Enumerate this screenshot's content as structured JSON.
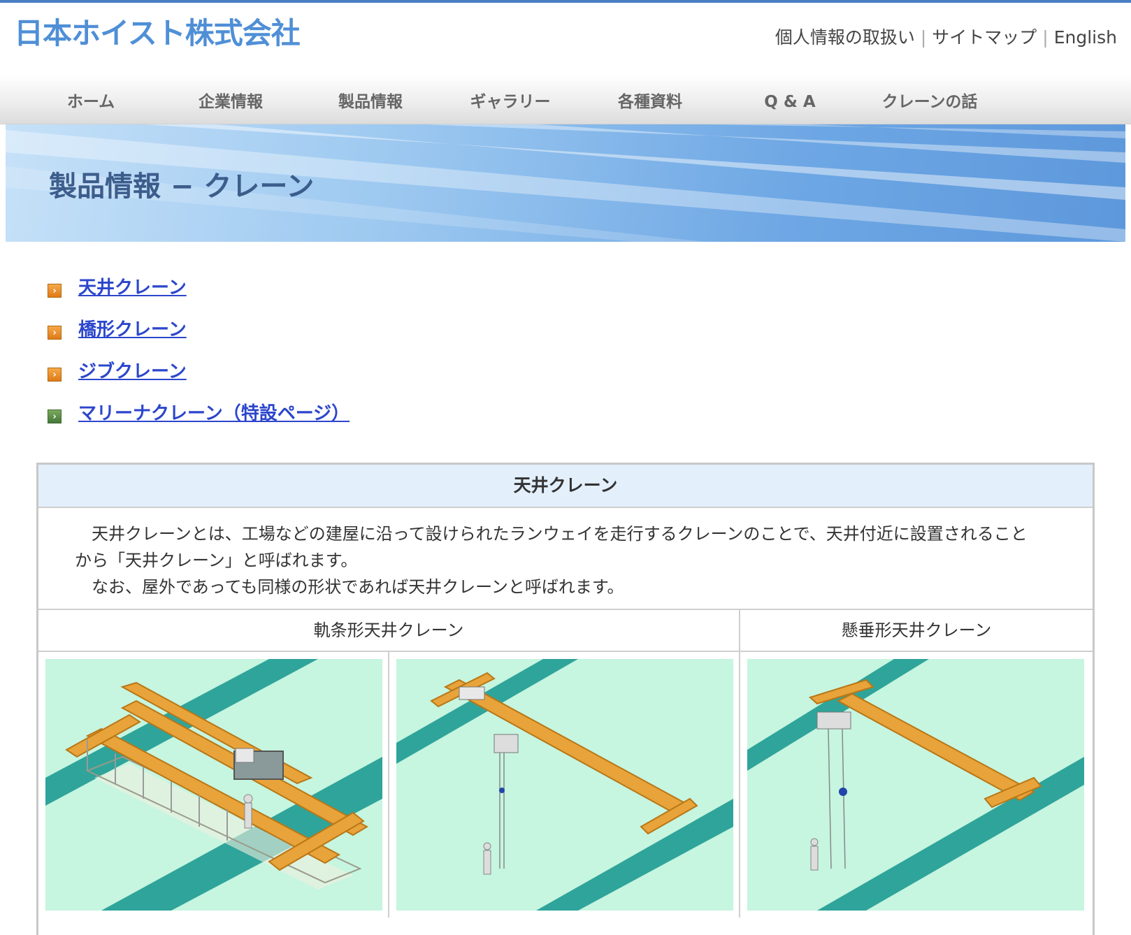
{
  "header": {
    "logo_text": "日本ホイスト株式会社",
    "util_links": [
      "個人情報の取扱い",
      "サイトマップ",
      "English"
    ]
  },
  "nav": {
    "items": [
      "ホーム",
      "企業情報",
      "製品情報",
      "ギャラリー",
      "各種資料",
      "Q & A",
      "クレーンの話"
    ]
  },
  "banner": {
    "title": "製品情報 − クレーン"
  },
  "product_links": [
    {
      "label": "天井クレーン",
      "bullet_color": "#e8841f"
    },
    {
      "label": "橋形クレーン",
      "bullet_color": "#e8841f"
    },
    {
      "label": "ジブクレーン",
      "bullet_color": "#e8841f"
    },
    {
      "label": "マリーナクレーン（特設ページ）",
      "bullet_color": "#4f8a45"
    }
  ],
  "table": {
    "title": "天井クレーン",
    "description_1": "天井クレーンとは、工場などの建屋に沿って設けられたランウェイを走行するクレーンのことで、天井付近に設置されることから「天井クレーン」と呼ばれます。",
    "description_2": "なお、屋外であっても同様の形状であれば天井クレーンと呼ばれます。",
    "sub_left": "軌条形天井クレーン",
    "sub_right": "懸垂形天井クレーン"
  },
  "colors": {
    "accent": "#4f8fd6",
    "link": "#2b46cc",
    "table_header_bg": "#e3effb",
    "illustration_bg": "#c6f5e0",
    "runway": "#2fa49a",
    "girder": "#e8a33a"
  }
}
